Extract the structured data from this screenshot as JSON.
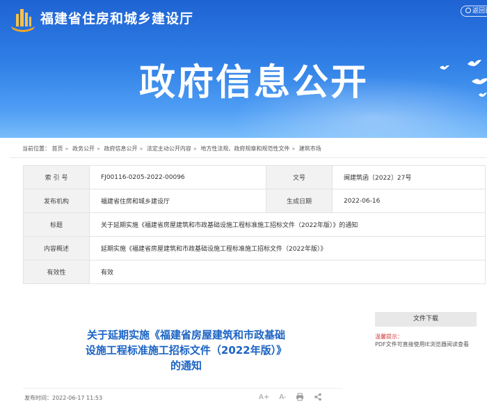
{
  "header": {
    "site_name": "福建省住房和城乡建设厅",
    "back_label": "返回首",
    "banner_title": "政府信息公开"
  },
  "breadcrumb": {
    "prefix": "当前位置：",
    "items": [
      "首页",
      "政务公开",
      "政府信息公开",
      "法定主动公开内容",
      "地方性法规、政府规章和规范性文件",
      "建筑市场"
    ]
  },
  "meta": {
    "index_label": "索 引 号",
    "index_value": "FJ00116-0205-2022-00096",
    "doc_no_label": "文号",
    "doc_no_value": "闽建筑函〔2022〕27号",
    "issuer_label": "发布机构",
    "issuer_value": "福建省住房和城乡建设厅",
    "date_label": "生成日期",
    "date_value": "2022-06-16",
    "title_label": "标题",
    "title_value": "关于延期实施《福建省房屋建筑和市政基础设施工程标准施工招标文件（2022年版）》的通知",
    "summary_label": "内容概述",
    "summary_value": "延期实施《福建省房屋建筑和市政基础设施工程标准施工招标文件（2022年版）》",
    "validity_label": "有效性",
    "validity_value": "有效"
  },
  "article": {
    "title_line1": "关于延期实施《福建省房屋建筑和市政基础",
    "title_line2": "设施工程标准施工招标文件（2022年版）》",
    "title_line3": "的通知",
    "publish_label": "发布时间：",
    "publish_time": "2022-06-17 11:53",
    "font_increase": "A+",
    "font_decrease": "A-"
  },
  "sidebar": {
    "download_heading": "文件下载",
    "tip_label": "温馨提示：",
    "tip_text": "PDF文件可直接使用IE浏览器阅读查看"
  },
  "colors": {
    "banner_top": "#1f63d3",
    "banner_bottom": "#79bdfa",
    "title_blue": "#1a63c4",
    "tip_red": "#d23b3b"
  }
}
